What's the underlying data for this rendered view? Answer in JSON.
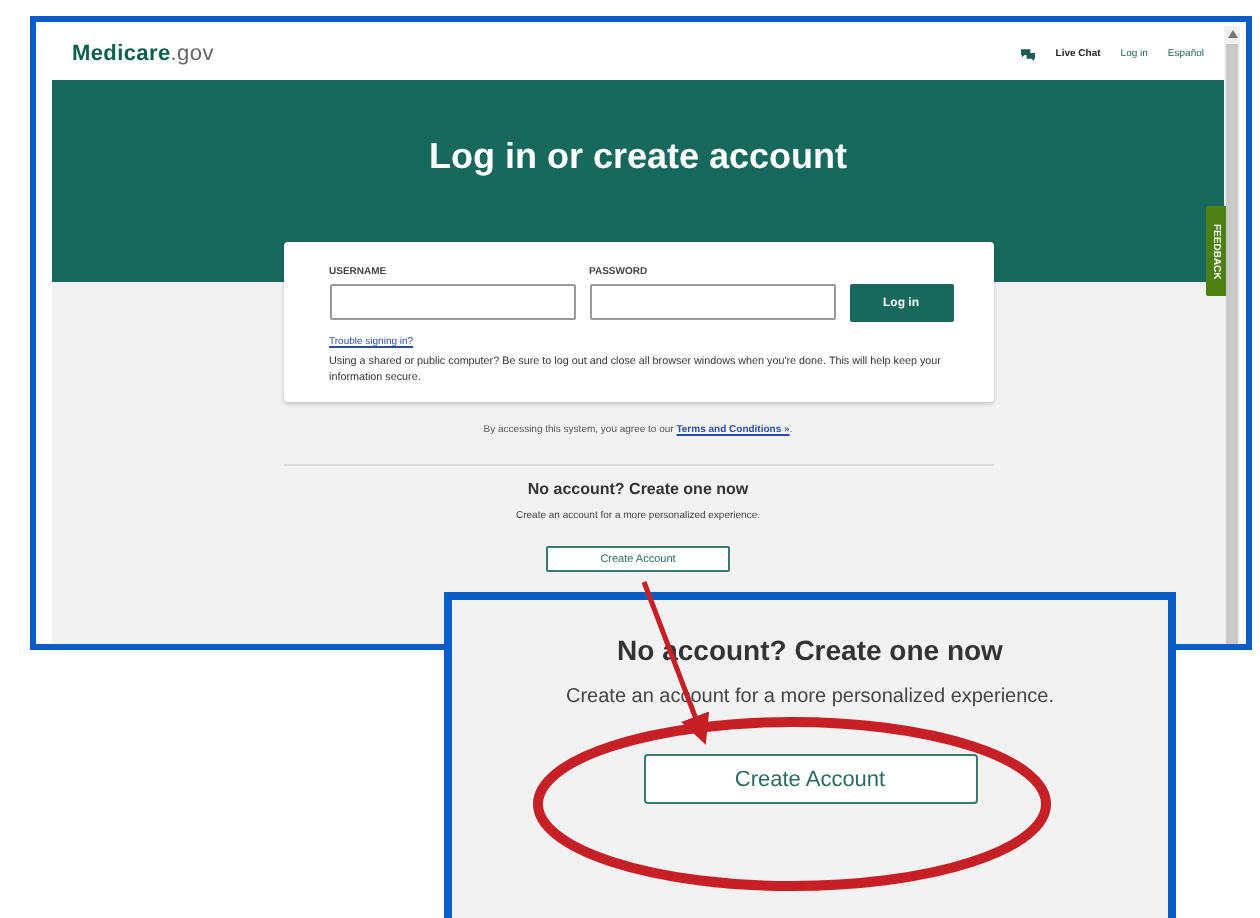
{
  "header": {
    "logo": "**Medicare**.gov",
    "links": [
      {
        "kind": "chat",
        "label": "Live Chat"
      },
      {
        "kind": "plain",
        "label": "Log in"
      },
      {
        "kind": "plain",
        "label": "Español"
      }
    ]
  },
  "hero": {
    "title": "Log in or create account"
  },
  "login": {
    "username_label": "USERNAME",
    "password_label": "PASSWORD",
    "button": "Log in",
    "help_link": "Trouble signing in?",
    "notice": "Using a shared or public computer? Be sure to log out and close all browser windows when you're done. This will help keep your information secure."
  },
  "terms": {
    "text": "By accessing this system, you agree to our",
    "link": "Terms and Conditions »",
    "end": "."
  },
  "feedback": "FEEDBACK",
  "signup": {
    "heading": "No account? Create one now",
    "text": "Create an account for a more personalized experience.",
    "button": "Create Account"
  },
  "callout": {
    "heading": "No account? Create one now",
    "text": "Create an account for a more personalized experience.",
    "button": "Create Account"
  }
}
